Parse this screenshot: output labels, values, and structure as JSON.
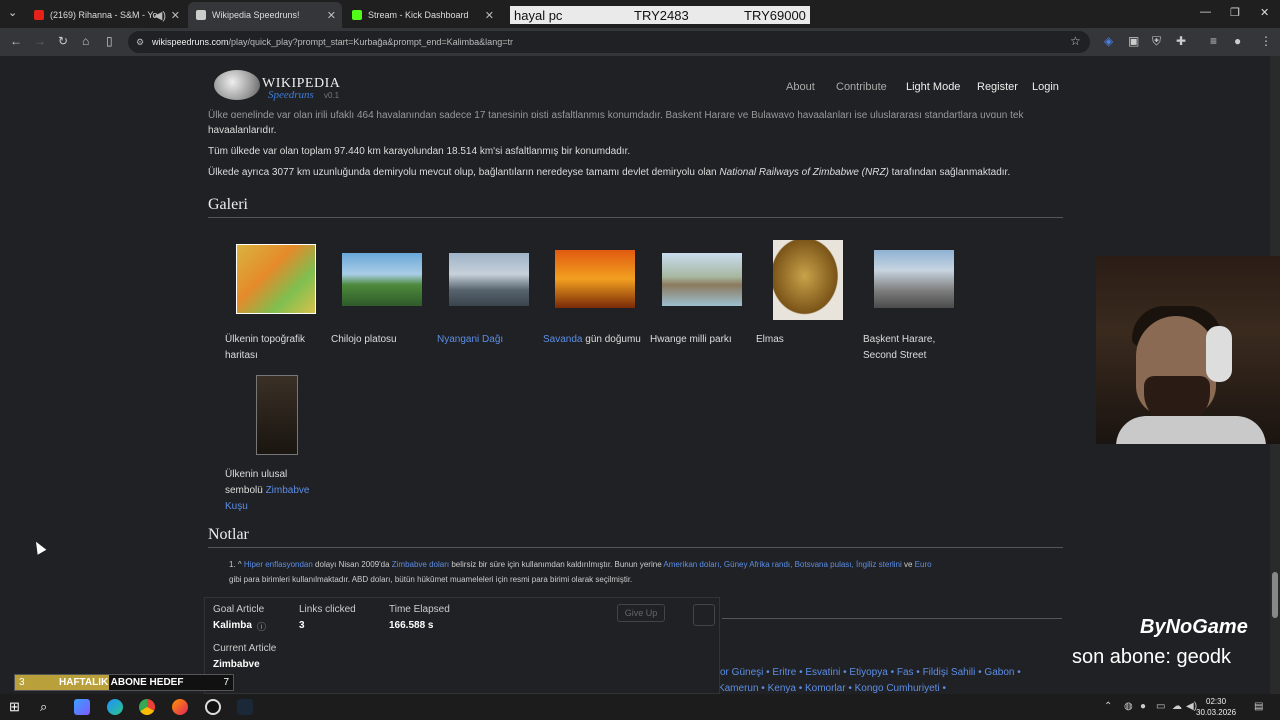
{
  "browser": {
    "tabs": [
      {
        "label": "(2169) Rihanna - S&M - Yo",
        "favicon_color": "#e62117"
      },
      {
        "label": "Wikipedia Speedruns!",
        "favicon_color": "#cccccc"
      },
      {
        "label": "Stream - Kick Dashboard",
        "favicon_color": "#53fc18"
      }
    ],
    "url_host": "wikispeedruns.com",
    "url_path": "/play/quick_play?prompt_start=Kurbağa&prompt_end=Kalimba&lang=tr"
  },
  "overlay_bar": {
    "name": "hayal pc",
    "current": "TRY2483",
    "target": "TRY69000"
  },
  "site": {
    "logo_title": "WIKIPEDIA",
    "logo_subtitle": "Speedruns",
    "logo_version": "v0.1",
    "nav": [
      "About",
      "Contribute",
      "Light Mode",
      "Register",
      "Login"
    ]
  },
  "article": {
    "para_top_1": "Ülke genelinde var olan irili ufaklı 464 havalanından sadece 17 tanesinin pisti asfaltlanmış konumdadır. Başkent Harare ve Bulawayo havaalanları ise uluslararası standartlara uygun tek",
    "para_top_2": "havaalanlarıdır.",
    "para_2": "Tüm ülkede var olan toplam 97.440 km karayolundan 18.514 km'si asfaltlanmış bir konumdadır.",
    "para_3_pre": "Ülkede ayrıca 3077 km uzunluğunda demiryolu mevcut olup, bağlantıların neredeyse tamamı devlet demiryolu olan ",
    "para_3_italic": "National Railways of Zimbabwe (NRZ)",
    "para_3_post": " tarafından sağlanmaktadır.",
    "gallery_heading": "Galeri",
    "gallery": [
      {
        "caption": "Ülkenin topoğrafik haritası"
      },
      {
        "caption": "Chilojo platosu"
      },
      {
        "caption": "Nyangani Dağı"
      },
      {
        "caption_link": "Savanda",
        "caption_rest": " gün doğumu"
      },
      {
        "caption": "Hwange milli parkı"
      },
      {
        "caption": "Elmas"
      },
      {
        "caption": "Başkent Harare, Second Street"
      },
      {
        "caption_pre": "Ülkenin ulusal sembolü ",
        "caption_link": "Zimbabve Kuşu"
      }
    ],
    "notes_heading": "Notlar",
    "note_1_marker": "1. ^",
    "note_1_link1": "Hiper enflasyondan",
    "note_1_text1": " dolayı Nisan 2009'da ",
    "note_1_link2": "Zimbabve doları",
    "note_1_text2": " belirsiz bir süre için kullanımdan kaldırılmıştır. Bunun yerine ",
    "note_1_link3": "Amerikan doları, Güney Afrika randı, Botsvana pulası, İngiliz sterlini",
    "note_1_text3": " ve ",
    "note_1_link4": "Euro",
    "note_1_line2": "gibi para birimleri kullanılmaktadır. ABD doları, bütün hükûmet muameleleri için resmi para birimi olarak seçilmiştir.",
    "footer_links_1": "or Güneşi • Eritre • Esvatini • Etiyopya • Fas • Fildişi Sahili • Gabon •",
    "footer_links_2": "Gambiya • Gana • Gine • Gine-Bissau • Güney Afrika Cumhuriyeti • Güney Sudan • Kamerun • Kenya • Komorlar • Kongo Cumhuriyeti •"
  },
  "game": {
    "goal_label": "Goal Article",
    "goal_value": "Kalimba",
    "links_label": "Links clicked",
    "links_value": "3",
    "time_label": "Time Elapsed",
    "time_value": "166.588 s",
    "current_label": "Current Article",
    "current_value": "Zimbabve",
    "give_up": "Give Up"
  },
  "stream_overlay": {
    "brand": "ByNoGame",
    "last_sub": "son abone: geodk",
    "goal_text": "HAFTALIK ABONE HEDEF",
    "goal_current": "3",
    "goal_target": "7",
    "goal_fraction": 0.43
  },
  "taskbar": {
    "time": "02:30",
    "date": "30.03.2026"
  },
  "colors": {
    "link": "#5c8ee6",
    "accent_kick": "#53fc18"
  }
}
